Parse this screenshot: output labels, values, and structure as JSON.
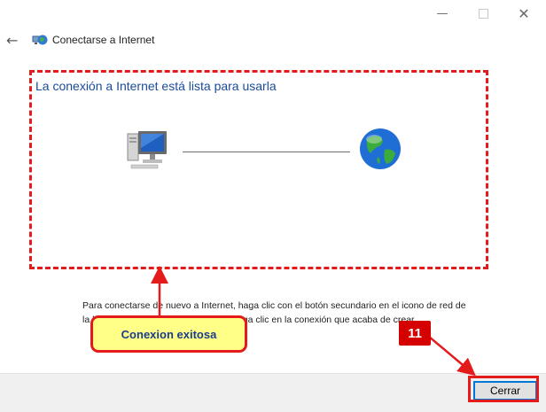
{
  "window": {
    "title": "Conectarse a Internet",
    "controls": {
      "minimize_icon": "minimize-icon",
      "maximize_icon": "maximize-icon",
      "close_icon": "close-icon"
    }
  },
  "content": {
    "heading": "La conexión a Internet está lista para usarla",
    "info_line1": "Para conectarse de nuevo a Internet, haga clic con el botón secundario en el icono de red de",
    "info_line2": "la barra de tareas y, a continuación, haga clic en la conexión que acaba de crear.",
    "illustration": {
      "left_icon": "computer-icon",
      "right_icon": "globe-icon"
    }
  },
  "footer": {
    "close_label": "Cerrar"
  },
  "annotations": {
    "callout_text": "Conexion exitosa",
    "step_number": "11",
    "accent_color": "#e31b1b",
    "callout_fill": "#ffff88"
  }
}
